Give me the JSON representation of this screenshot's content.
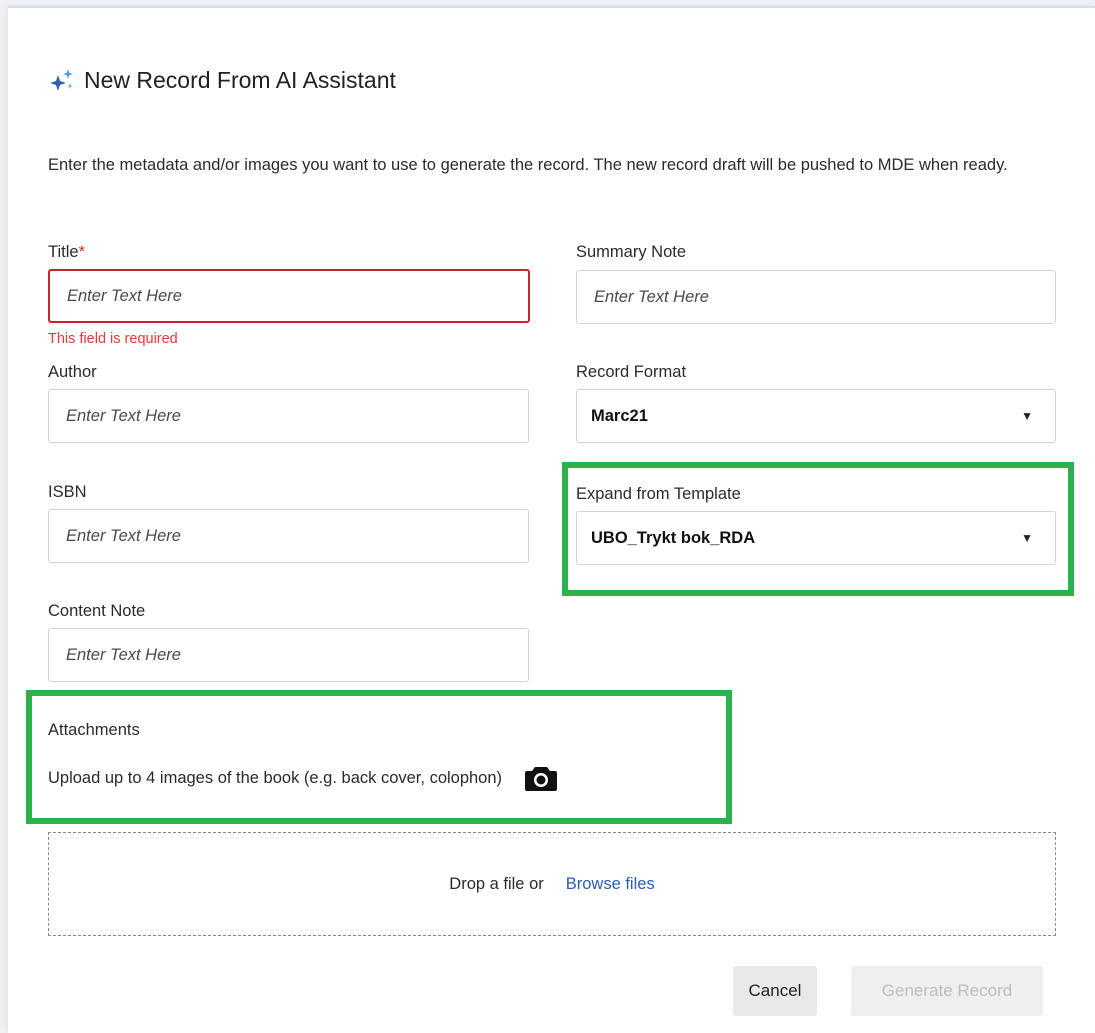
{
  "dialog": {
    "title": "New Record From AI Assistant",
    "intro": "Enter the metadata and/or images you want to use to generate the record. The new record draft will be pushed to MDE when ready."
  },
  "fields": {
    "title": {
      "label": "Title",
      "required_mark": "*",
      "placeholder": "Enter Text Here",
      "value": "",
      "error": "This field is required"
    },
    "summary_note": {
      "label": "Summary Note",
      "placeholder": "Enter Text Here",
      "value": ""
    },
    "author": {
      "label": "Author",
      "placeholder": "Enter Text Here",
      "value": ""
    },
    "record_format": {
      "label": "Record Format",
      "selected": "Marc21"
    },
    "isbn": {
      "label": "ISBN",
      "placeholder": "Enter Text Here",
      "value": ""
    },
    "template": {
      "label": "Expand from Template",
      "selected": "UBO_Trykt bok_RDA"
    },
    "content_note": {
      "label": "Content Note",
      "placeholder": "Enter Text Here",
      "value": ""
    }
  },
  "attachments": {
    "label": "Attachments",
    "description": "Upload up to 4 images of the book (e.g. back cover, colophon)",
    "icon": "camera-icon",
    "dropzone_text": "Drop a file or",
    "browse_label": "Browse files"
  },
  "footer": {
    "cancel_label": "Cancel",
    "generate_label": "Generate Record"
  },
  "colors": {
    "highlight": "#2db14a",
    "error": "#c62828",
    "link": "#2a5db0"
  }
}
